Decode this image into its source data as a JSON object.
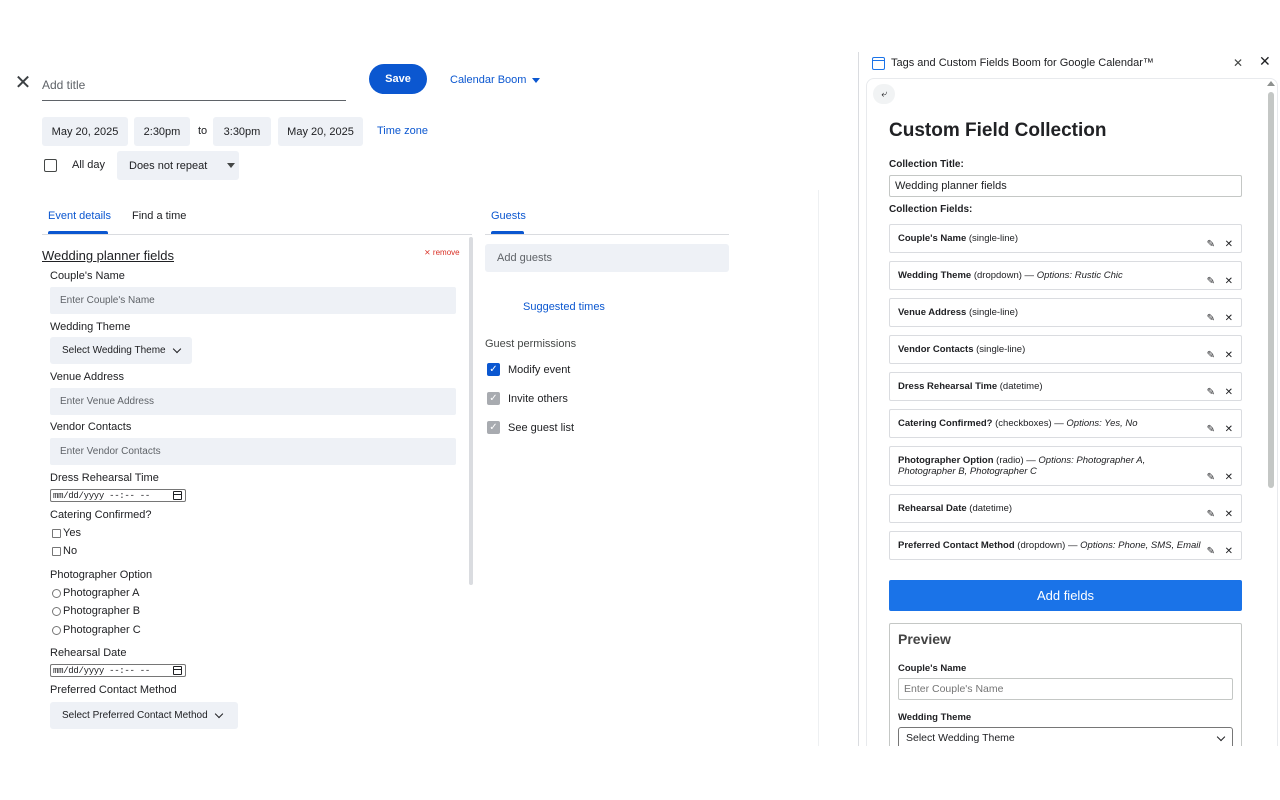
{
  "event": {
    "title_placeholder": "Add title",
    "save_label": "Save",
    "calendar_name": "Calendar Boom",
    "start_date": "May 20, 2025",
    "start_time": "2:30pm",
    "to_label": "to",
    "end_time": "3:30pm",
    "end_date": "May 20, 2025",
    "timezone_label": "Time zone",
    "all_day_label": "All day",
    "repeat_value": "Does not repeat",
    "tabs": [
      {
        "label": "Event details"
      },
      {
        "label": "Find a time"
      }
    ],
    "guests_tab_label": "Guests"
  },
  "form": {
    "title": "Wedding planner fields",
    "remove_label": "⨯ remove",
    "couples_name": {
      "label": "Couple's Name",
      "placeholder": "Enter Couple's Name"
    },
    "wedding_theme": {
      "label": "Wedding Theme",
      "selected": "Select Wedding Theme"
    },
    "venue_address": {
      "label": "Venue Address",
      "placeholder": "Enter Venue Address"
    },
    "vendor_contacts": {
      "label": "Vendor Contacts",
      "placeholder": "Enter Vendor Contacts"
    },
    "dress_rehearsal": {
      "label": "Dress Rehearsal Time",
      "value": "mm/dd/yyyy --:-- --"
    },
    "catering": {
      "label": "Catering Confirmed?",
      "options": [
        "Yes",
        "No"
      ]
    },
    "photographer": {
      "label": "Photographer Option",
      "options": [
        "Photographer A",
        "Photographer B",
        "Photographer C"
      ]
    },
    "rehearsal_date": {
      "label": "Rehearsal Date",
      "value": "mm/dd/yyyy --:-- --"
    },
    "contact_method": {
      "label": "Preferred Contact Method",
      "selected": "Select Preferred Contact Method"
    }
  },
  "guests": {
    "add_placeholder": "Add guests",
    "suggested_times": "Suggested times",
    "permissions_title": "Guest permissions",
    "permissions": [
      {
        "label": "Modify event",
        "checked": true
      },
      {
        "label": "Invite others",
        "checked": true
      },
      {
        "label": "See guest list",
        "checked": true
      }
    ]
  },
  "panel": {
    "app_title": "Tags and Custom Fields Boom for Google Calendar™",
    "back_glyph": "⤶",
    "heading": "Custom Field Collection",
    "collection_title_label": "Collection Title:",
    "collection_title_value": "Wedding planner fields",
    "collection_fields_label": "Collection Fields:",
    "fields": [
      {
        "name": "Couple's Name",
        "type": "(single-line)",
        "options": ""
      },
      {
        "name": "Wedding Theme",
        "type": "(dropdown) —",
        "options": "Options: Rustic Chic"
      },
      {
        "name": "Venue Address",
        "type": "(single-line)",
        "options": ""
      },
      {
        "name": "Vendor Contacts",
        "type": "(single-line)",
        "options": ""
      },
      {
        "name": "Dress Rehearsal Time",
        "type": "(datetime)",
        "options": ""
      },
      {
        "name": "Catering Confirmed?",
        "type": "(checkboxes) —",
        "options": "Options: Yes, No"
      },
      {
        "name": "Photographer Option",
        "type": "(radio) —",
        "options": "Options: Photographer A, Photographer B, Photographer C"
      },
      {
        "name": "Rehearsal Date",
        "type": "(datetime)",
        "options": ""
      },
      {
        "name": "Preferred Contact Method",
        "type": "(dropdown) —",
        "options": "Options: Phone, SMS, Email"
      }
    ],
    "add_fields_label": "Add fields",
    "preview": {
      "heading": "Preview",
      "couples_name_label": "Couple's Name",
      "couples_name_placeholder": "Enter Couple's Name",
      "wedding_theme_label": "Wedding Theme",
      "wedding_theme_selected": "Select Wedding Theme"
    }
  },
  "colors": {
    "accent": "#0b57d0",
    "panel_button": "#1a73e8",
    "remove_red": "#d93025",
    "chip_bg": "#eef1f6"
  }
}
